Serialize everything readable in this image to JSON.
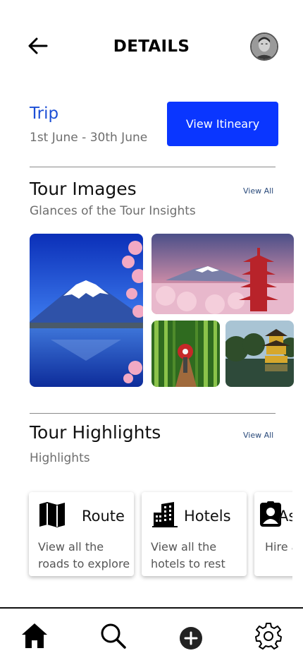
{
  "header": {
    "title": "DETAILS"
  },
  "trip": {
    "title": "Trip",
    "dates": "1st June - 30th June",
    "itinerary_button": "View Itineary"
  },
  "tour_images": {
    "title": "Tour Images",
    "subtitle": "Glances of the Tour Insights",
    "view_all": "View All",
    "images": [
      "mount-fuji-lake",
      "pagoda-cherry-blossom",
      "bamboo-forest-walker",
      "golden-pavilion"
    ]
  },
  "tour_highlights": {
    "title": "Tour Highlights",
    "subtitle": "Highlights",
    "view_all": "View All",
    "cards": [
      {
        "icon": "map-icon",
        "title": "Route",
        "desc": "View all the roads to explore"
      },
      {
        "icon": "building-icon",
        "title": "Hotels",
        "desc": "View all the hotels to rest"
      },
      {
        "icon": "id-badge-icon",
        "title": "Assistance",
        "desc": "Hire a transport"
      }
    ]
  },
  "bottom_nav": {
    "items": [
      "home-icon",
      "search-icon",
      "plus-circle-icon",
      "gear-icon"
    ],
    "active": "home-icon"
  },
  "colors": {
    "primary": "#0a36ff",
    "trip_title": "#1c4fd6",
    "muted": "#6e6e6e"
  }
}
